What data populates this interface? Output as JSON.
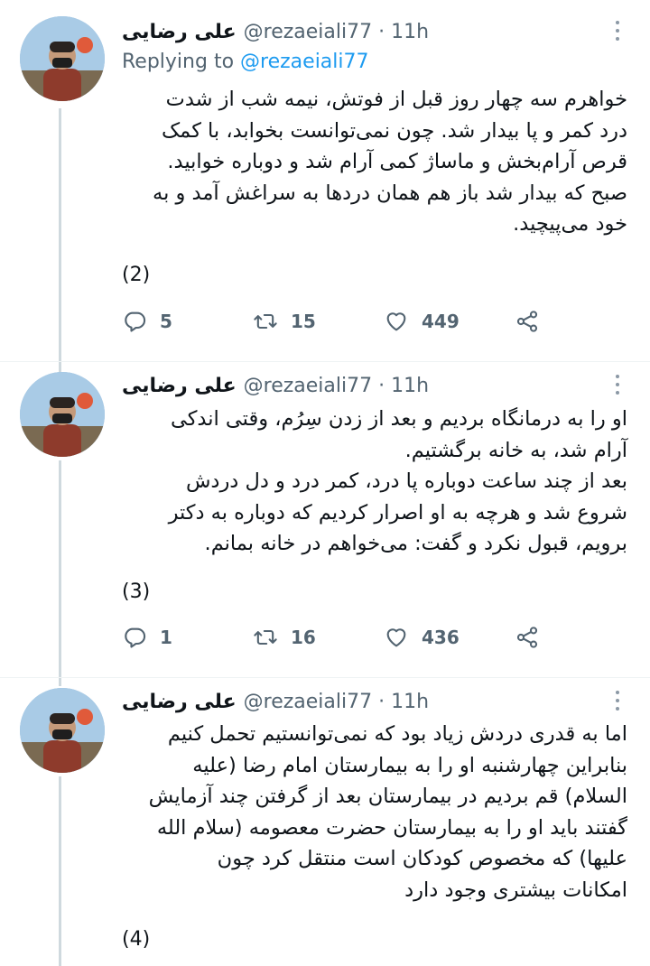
{
  "tweets": [
    {
      "name": "علی رضایی",
      "handle": "@rezaeiali77",
      "separator": "·",
      "time": "11h",
      "replying_label": "Replying to",
      "replying_to": "@rezaeiali77",
      "lines": [
        "خواهرم سه چهار روز قبل از فوتش، نیمه شب از شدت",
        "درد کمر و پا بیدار شد. چون نمی‌توانست بخوابد، با کمک",
        "قرص آرام‌بخش و ماساژ کمی آرام شد و دوباره خوابید.",
        "صبح که بیدار شد باز هم همان دردها به سراغش آمد و به",
        "خود می‌پیچید."
      ],
      "number": "(2)",
      "replies": "5",
      "retweets": "15",
      "likes": "449"
    },
    {
      "name": "علی رضایی",
      "handle": "@rezaeiali77",
      "separator": "·",
      "time": "11h",
      "lines": [
        "او را به درمانگاه بردیم و بعد از زدن سِرُم، وقتی اندکی",
        "آرام شد، به خانه برگشتیم.",
        "بعد از چند ساعت دوباره پا درد، کمر درد و دل دردش",
        "شروع شد و هرچه به او اصرار کردیم که دوباره به دکتر",
        "برویم، قبول نکرد و گفت: می‌خواهم در خانه بمانم."
      ],
      "number": "(3)",
      "replies": "1",
      "retweets": "16",
      "likes": "436"
    },
    {
      "name": "علی رضایی",
      "handle": "@rezaeiali77",
      "separator": "·",
      "time": "11h",
      "lines": [
        "اما به قدری دردش زیاد بود که نمی‌توانستیم تحمل کنیم",
        "بنابراین چهارشنبه او را به بیمارستان امام رضا (علیه",
        "السلام) قم بردیم در بیمارستان بعد از گرفتن چند آزمایش",
        "گفتند باید او را به بیمارستان حضرت معصومه (سلام الله",
        "علیها) که مخصوص کودکان است منتقل کرد چون",
        "امکانات بیشتری وجود دارد"
      ],
      "number": "(4)"
    }
  ],
  "colors": {
    "accent": "#1d9bf0",
    "secondary_text": "#536471",
    "thread_line": "#cfd9de"
  },
  "icons": [
    "reply-icon",
    "retweet-icon",
    "like-icon",
    "share-icon",
    "more-icon"
  ]
}
